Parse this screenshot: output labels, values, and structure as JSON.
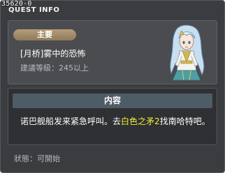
{
  "window": {
    "quest_id": "35620-0",
    "title": "QUEST INFO"
  },
  "quest": {
    "category_badge": "主要",
    "name": "[月桥]雾中的恐怖",
    "recommended_level": "建議等級：245以上"
  },
  "content": {
    "header": "内容",
    "text_before": "诺巴舰船发来紧急呼叫。去",
    "highlight_text": "白色之矛2",
    "text_after": "找南哈特吧。"
  },
  "status": {
    "text": "狀態：可開始"
  },
  "npc": {
    "icon": "npc-portrait-icon"
  },
  "colors": {
    "window_bg": "#3a3c40",
    "info_panel_bg": "#4b4c4f",
    "content_panel_bg": "#2f3033",
    "content_header_bg": "#4e5c66",
    "badge_color": "#a88f69",
    "highlight": "#f5ef3a"
  }
}
